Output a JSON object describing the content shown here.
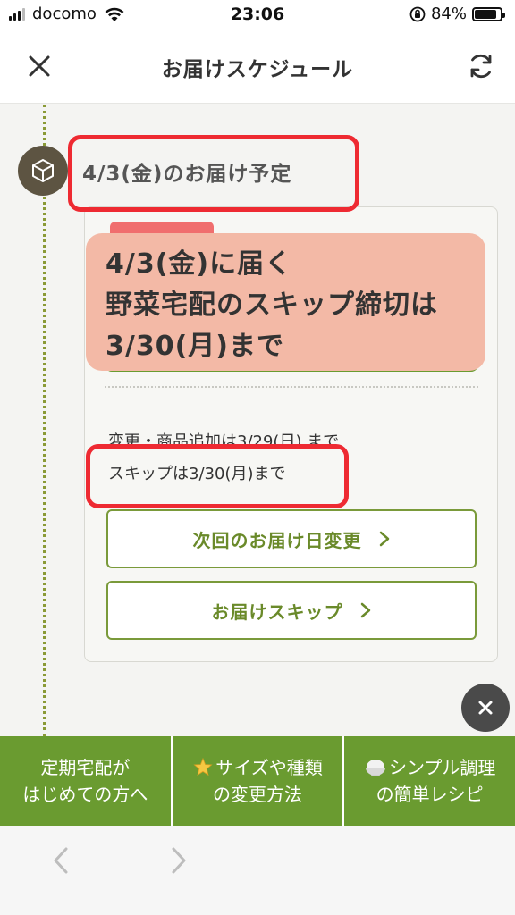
{
  "status_bar": {
    "carrier": "docomo",
    "time": "23:06",
    "battery_percent": "84%",
    "battery_level": 0.84
  },
  "header": {
    "title": "お届けスケジュール"
  },
  "schedule": {
    "date_heading": "4/3(金)のお届け予定",
    "change_deadline": "変更・商品追加は3/29(日) まで",
    "skip_deadline": "スキップは3/30(月)まで",
    "change_date_button": "次回のお届け日変更",
    "skip_button": "お届けスキップ"
  },
  "callout": {
    "line1": "4/3(金)に届く",
    "line2": "野菜宅配のスキップ締切は",
    "line3": "3/30(月)まで"
  },
  "bottom_links": {
    "first_time": {
      "line1": "定期宅配が",
      "line2": "はじめての方へ"
    },
    "size_change": {
      "line1": "サイズや種類",
      "line2": "の変更方法"
    },
    "recipe": {
      "line1": "シンプル調理",
      "line2": "の簡単レシピ"
    }
  },
  "colors": {
    "accent_green": "#6a9b30",
    "highlight_red": "#ee2a32",
    "callout_bg": "#f3b9a6"
  },
  "icons": {
    "close": "close-icon",
    "refresh": "refresh-icon",
    "box": "box-icon",
    "star": "star-icon",
    "rice_bowl": "rice-bowl-icon"
  }
}
